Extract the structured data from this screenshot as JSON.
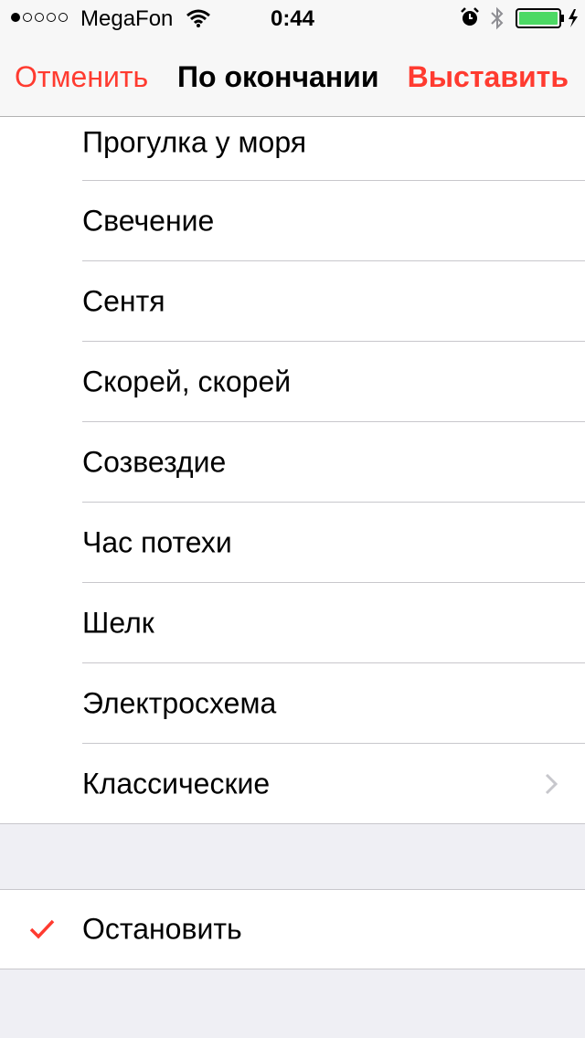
{
  "status_bar": {
    "carrier": "MegaFon",
    "time": "0:44",
    "signal_strength_bars": 1,
    "signal_total_bars": 5,
    "icons": [
      "wifi-icon",
      "alarm-icon",
      "bluetooth-icon",
      "battery-charging-icon"
    ]
  },
  "nav": {
    "cancel_label": "Отменить",
    "title": "По окончании",
    "set_label": "Выставить",
    "accent_color": "#ff3b30"
  },
  "tones": [
    {
      "label": "Прогулка у моря"
    },
    {
      "label": "Свечение"
    },
    {
      "label": "Сентя"
    },
    {
      "label": "Скорей, скорей"
    },
    {
      "label": "Созвездие"
    },
    {
      "label": "Час потехи"
    },
    {
      "label": "Шелк"
    },
    {
      "label": "Электросхема"
    },
    {
      "label": "Классические",
      "has_disclosure": true
    }
  ],
  "stop_option": {
    "label": "Остановить",
    "selected": true
  }
}
